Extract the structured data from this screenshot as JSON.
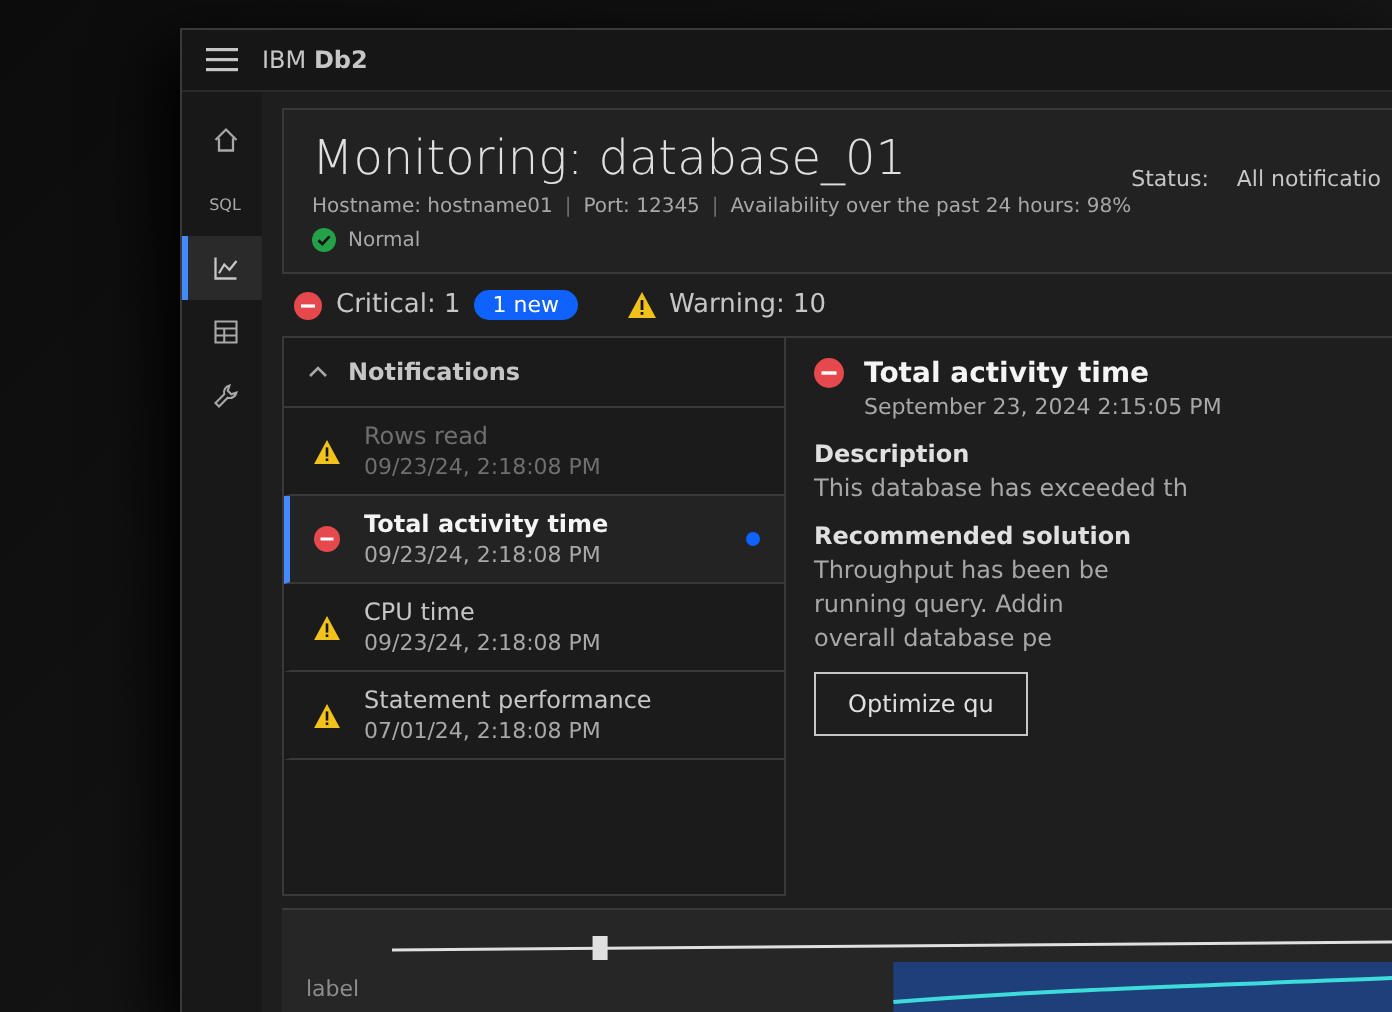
{
  "header": {
    "product": "IBM **Db2**"
  },
  "rail": [
    {
      "kind": "home",
      "selected": false
    },
    {
      "kind": "sql",
      "label": "SQL",
      "selected": false
    },
    {
      "kind": "chart",
      "selected": true
    },
    {
      "kind": "table",
      "selected": false
    },
    {
      "kind": "wrench",
      "selected": false
    }
  ],
  "page": {
    "title": "Monitoring: database_01",
    "hostname": "Hostname: hostname01",
    "separator": "|",
    "port": "Port: 12345",
    "availability": "Availability over the past 24 hours: 98%",
    "state": {
      "kind": "normal",
      "label": "Normal"
    },
    "separator_2": "|",
    "status_label": "Status:",
    "status_value": "All notificatio"
  },
  "summary": {
    "critical": "Critical: 1",
    "new_badge": "1 new",
    "warning": "Warning: 10"
  },
  "notifications": {
    "title": "Notifications",
    "expanded": true,
    "items": [
      {
        "kind": "warning",
        "title": "Rows read",
        "time": "09/23/24, 2:18:08 PM",
        "selected": false,
        "read": true,
        "new": false
      },
      {
        "kind": "critical",
        "title": "Total activity time",
        "time": "09/23/24, 2:18:08 PM",
        "selected": true,
        "read": false,
        "new": true
      },
      {
        "kind": "warning",
        "title": "CPU time",
        "time": "09/23/24, 2:18:08 PM",
        "selected": false,
        "read": false,
        "new": false
      },
      {
        "kind": "warning",
        "title": "Statement performance",
        "time": "07/01/24, 2:18:08 PM",
        "selected": false,
        "read": false,
        "new": false
      }
    ]
  },
  "detail": {
    "kind": "critical",
    "title": "Total activity time",
    "time": "September 23, 2024 2:15:05 PM",
    "description_heading": "Description",
    "description": "This database has exceeded th",
    "solution_heading": "Recommended solution",
    "solution_lines": [
      "Throughput has been be",
      "running query. Addin",
      "overall database pe"
    ],
    "button": "Optimize qu"
  },
  "chart_panel": {
    "label": "label"
  }
}
